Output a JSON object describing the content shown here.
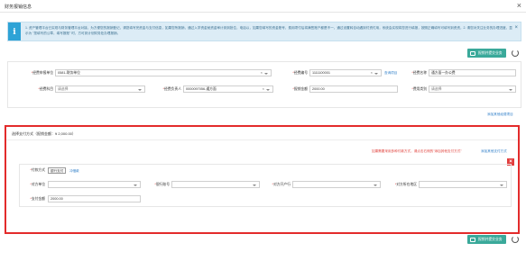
{
  "title": "财务报销信息",
  "notice_text": "1. 资产管理平台已实现与财务管理平台对接，为方便您的报销登记，请您填写完资金与支付信息，如果您所报销，通过入学资金就资金审计到到批位，电话以，如果您填写的资金账号，费用项付后将满签账户都是不一，通过设置转自动遇到付资付用，系统会实现将您进行填报，按照正确填写可填写到资资，2. 请您对关注业务的办理进度，显示为 \"您填写的公章，填写报账\" 时，方可到计划财务处办理报销。",
  "save_label": "报销并提交业务",
  "fields": {
    "dept_label": "经费申报单位",
    "dept_value": "0581-财务单位",
    "code_label": "经费编号",
    "code_value": "1111100001",
    "query_link": "查询项目",
    "name_label": "经费名称",
    "name_value": "通方面一办公费",
    "subject_label": "经费科目",
    "subject_value": "请选择",
    "leader_label": "经费负责人",
    "leader_value": "0000097056-通方面",
    "amount_label": "报销金额",
    "amount_value": "2000.00",
    "type_label": "费用类别",
    "type_value": "请选择"
  },
  "add_other_link": "添加其他经费项目",
  "payment": {
    "header": "选择支付方式（报销金额：¥ 2,000.00）",
    "warn": "如果需要采用多种付款方式，请点击右侧的\"添加其他支付方式\"",
    "add_link": "添加其他支付方式",
    "method_label": "付款方式",
    "tab_active": "银行支付",
    "tab_other": "冲借款",
    "unit_label": "对方单位",
    "bank_label": "银行账号",
    "account_label": "对方开户行",
    "city_label": "对方所在地区",
    "pay_label": "支付金额",
    "pay_value": "2000.00",
    "delete": "×"
  },
  "close_glyph": "×",
  "refresh_icon": "refresh-icon"
}
